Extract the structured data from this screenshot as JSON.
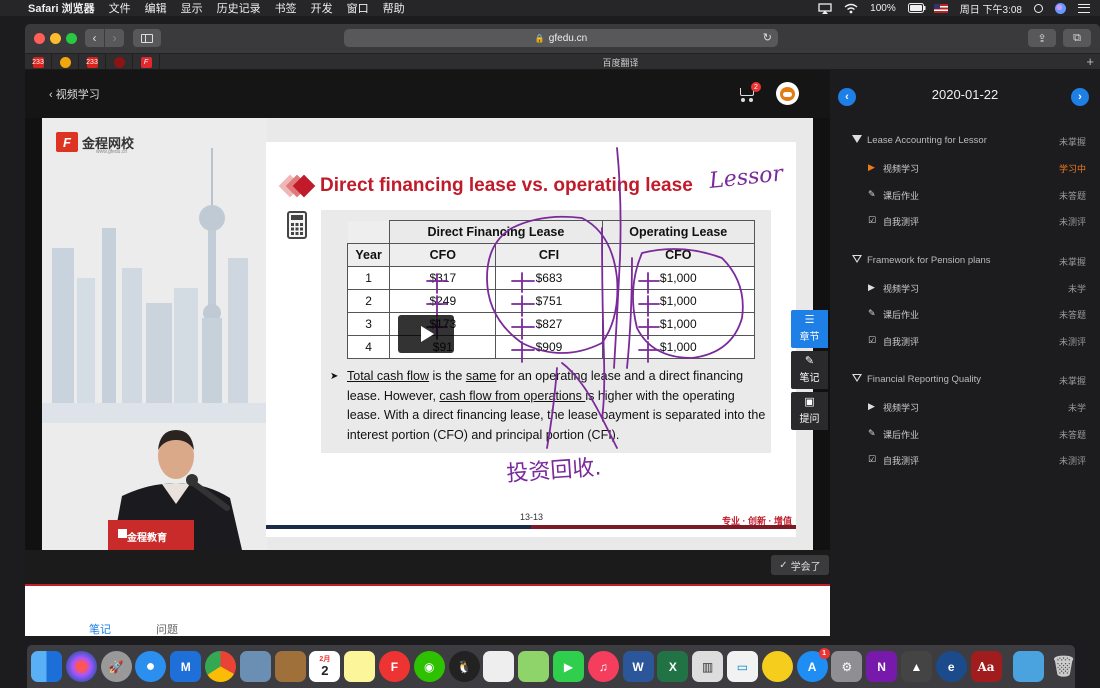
{
  "menubar": {
    "app_name": "Safari 浏览器",
    "items": [
      "文件",
      "编辑",
      "显示",
      "历史记录",
      "书签",
      "开发",
      "窗口",
      "帮助"
    ],
    "battery": "100%",
    "datetime": "周日 下午3:08"
  },
  "browser": {
    "address": "gfedu.cn",
    "active_tab_title": "百度翻译",
    "new_tab_label": "+"
  },
  "page": {
    "back_label": "视频学习",
    "cart_count": "2",
    "brand_name": "金程网校",
    "brand_url": "www.gfedu.cn"
  },
  "slide": {
    "title": "Direct financing lease vs. operating lease",
    "table": {
      "group_headers": [
        "Direct Financing Lease",
        "Operating Lease"
      ],
      "sub_headers": [
        "Year",
        "CFO",
        "CFI",
        "CFO"
      ],
      "rows": [
        [
          "1",
          "$317",
          "$683",
          "$1,000"
        ],
        [
          "2",
          "$249",
          "$751",
          "$1,000"
        ],
        [
          "3",
          "$173",
          "$827",
          "$1,000"
        ],
        [
          "4",
          "$91",
          "$909",
          "$1,000"
        ]
      ]
    },
    "bullet": {
      "p1": "Total cash flow",
      "p2": " is the ",
      "p3": "same",
      "p4": " for an operating lease and a direct financing lease. However, ",
      "p5": "cash flow from operations ",
      "p6": "is higher with the operating lease. With a direct financing lease, the lease payment is separated into the interest portion (CFO) and principal portion (CFI)."
    },
    "page_number": "13-13",
    "slogan": "专业 · 创新 · 增值",
    "annotation_lessor": "Lessor",
    "annotation_cn": "投资回收."
  },
  "side_tabs": [
    {
      "label": "章节"
    },
    {
      "label": "笔记"
    },
    {
      "label": "提问"
    }
  ],
  "controls": {
    "learned_label": "学会了"
  },
  "notes": {
    "tab_notes": "笔记",
    "tab_questions": "问题"
  },
  "course": {
    "date": "2020-01-22",
    "chapters": [
      {
        "title": "Lease Accounting for Lessor",
        "status": "未掌握",
        "items": [
          {
            "label": "视频学习",
            "status": "学习中"
          },
          {
            "label": "课后作业",
            "status": "未答题"
          },
          {
            "label": "自我测评",
            "status": "未测评"
          }
        ]
      },
      {
        "title": "Framework for Pension plans",
        "status": "未掌握",
        "items": [
          {
            "label": "视频学习",
            "status": "未学"
          },
          {
            "label": "课后作业",
            "status": "未答题"
          },
          {
            "label": "自我测评",
            "status": "未测评"
          }
        ]
      },
      {
        "title": "Financial Reporting Quality",
        "status": "未掌握",
        "items": [
          {
            "label": "视频学习",
            "status": "未学"
          },
          {
            "label": "课后作业",
            "status": "未答题"
          },
          {
            "label": "自我测评",
            "status": "未测评"
          }
        ]
      }
    ]
  },
  "dock": {
    "calendar_month": "2月",
    "calendar_day": "2",
    "appstore_badge": "1"
  },
  "colors": {
    "accent": "#1e7fe6",
    "slide_red": "#c11b2b",
    "ink_purple": "#7a2a9a",
    "status_orange": "#f07a1a"
  }
}
